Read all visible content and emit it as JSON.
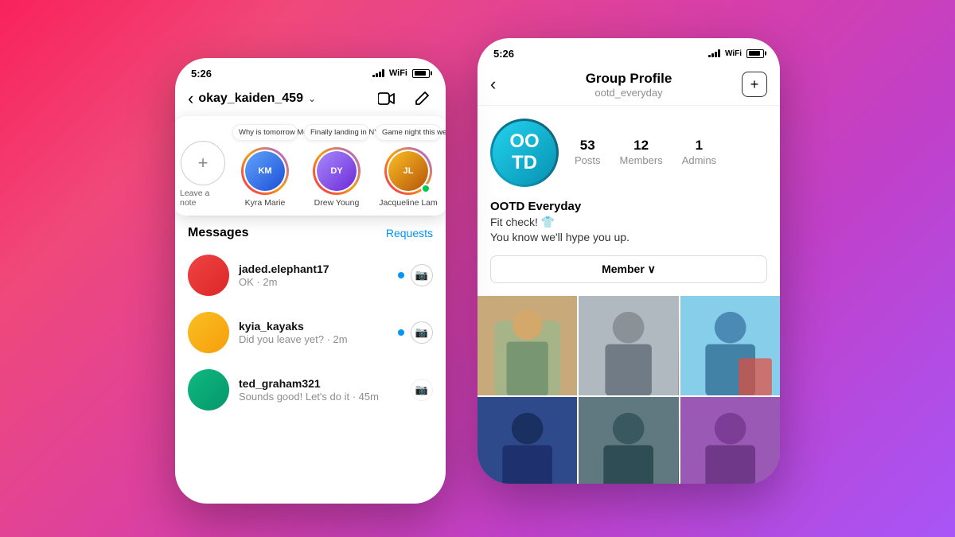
{
  "background": {
    "gradient": "linear-gradient(135deg, #f9225b 0%, #d63faa 50%, #a855f7 100%)"
  },
  "left_phone": {
    "status_bar": {
      "time": "5:26"
    },
    "header": {
      "back_icon": "‹",
      "username": "okay_kaiden_459",
      "chevron": "∨",
      "video_icon": "□",
      "edit_icon": "✏"
    },
    "stories": [
      {
        "id": "self",
        "label": "Leave a note",
        "has_ring": false,
        "is_add": true,
        "color": "#e5e7eb"
      },
      {
        "id": "kyra",
        "label": "Kyra Marie",
        "bubble": "Why is tomorrow Monday!? 😩",
        "has_ring": true,
        "color": "#3b82f6",
        "initials": "KM"
      },
      {
        "id": "drew",
        "label": "Drew Young",
        "bubble": "Finally landing in NYC! ❤️",
        "has_ring": true,
        "color": "#7c3aed",
        "initials": "DY"
      },
      {
        "id": "jacq",
        "label": "Jacqueline Lam",
        "bubble": "Game night this weekend? 🎱",
        "has_ring": true,
        "online": true,
        "color": "#f59e0b",
        "initials": "JL"
      }
    ],
    "messages": {
      "title": "Messages",
      "requests_label": "Requests",
      "items": [
        {
          "username": "jaded.elephant17",
          "preview": "OK · 2m",
          "unread": true,
          "color": "#ef4444"
        },
        {
          "username": "kyia_kayaks",
          "preview": "Did you leave yet? · 2m",
          "unread": true,
          "color": "#f59e0b"
        },
        {
          "username": "ted_graham321",
          "preview": "Sounds good! Let's do it · 45m",
          "unread": false,
          "color": "#10b981"
        }
      ]
    }
  },
  "right_phone": {
    "status_bar": {
      "time": "5:26"
    },
    "header": {
      "back_icon": "‹",
      "title": "Group Profile",
      "subtitle": "ootd_everyday",
      "add_icon": "+"
    },
    "group": {
      "avatar_text": "OO\nTD",
      "name": "OOTD Everyday",
      "bio_line1": "Fit check! 👕",
      "bio_line2": "You know we'll hype you up.",
      "posts": "53",
      "posts_label": "Posts",
      "members": "12",
      "members_label": "Members",
      "admins": "1",
      "admins_label": "Admins",
      "member_button": "Member ∨"
    },
    "photos": [
      {
        "id": 1,
        "color_class": "photo-1"
      },
      {
        "id": 2,
        "color_class": "photo-2"
      },
      {
        "id": 3,
        "color_class": "photo-3"
      },
      {
        "id": 4,
        "color_class": "photo-4"
      },
      {
        "id": 5,
        "color_class": "photo-5"
      },
      {
        "id": 6,
        "color_class": "photo-6"
      }
    ]
  }
}
